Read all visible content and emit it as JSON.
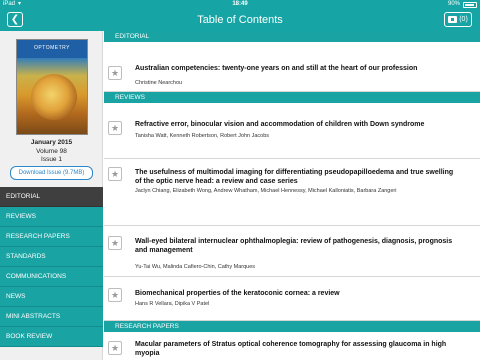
{
  "status_bar": {
    "device": "iPad",
    "time": "18:49",
    "battery": "90%",
    "battery_level": 0.9
  },
  "nav": {
    "title": "Table of Contents",
    "back_icon": "chevron-left-icon",
    "download_count": "(0)",
    "download_icon": "box-icon"
  },
  "issue": {
    "journal_cover_title": "OPTOMETRY",
    "date": "January 2015",
    "volume": "Volume 98",
    "issue": "Issue 1",
    "download_label": "Download Issue (9.7MB)"
  },
  "menu": [
    {
      "label": "EDITORIAL",
      "active": true
    },
    {
      "label": "REVIEWS",
      "active": false
    },
    {
      "label": "RESEARCH PAPERS",
      "active": false
    },
    {
      "label": "STANDARDS",
      "active": false
    },
    {
      "label": "COMMUNICATIONS",
      "active": false
    },
    {
      "label": "NEWS",
      "active": false
    },
    {
      "label": "MINI ABSTRACTS",
      "active": false
    },
    {
      "label": "BOOK REVIEW",
      "active": false
    }
  ],
  "sections": {
    "editorial": {
      "header": "EDITORIAL",
      "articles": [
        {
          "title": "Australian competencies: twenty-one years on and still at the heart of our profession",
          "authors": "Christine Nearchou"
        }
      ]
    },
    "reviews": {
      "header": "REVIEWS",
      "articles": [
        {
          "title": "Refractive error, binocular vision and accommodation of children with Down syndrome",
          "authors": "Tanisha Watt, Kenneth Robertson, Robert John Jacobs"
        },
        {
          "title": "The usefulness of multimodal imaging for differentiating pseudopapilloedema and true swelling of the optic nerve head: a review and case series",
          "authors": "Jaclyn Chiang, Elizabeth Wong, Andrew Whatham, Michael Hennessy, Michael Kalloniatis, Barbara Zangeri"
        },
        {
          "title": "Wall-eyed bilateral internuclear ophthalmoplegia: review of pathogenesis, diagnosis, prognosis and management",
          "authors": "Yu-Tai Wu, Malinda Cafiero-Chin, Cathy Marques"
        },
        {
          "title": "Biomechanical properties of the keratoconic cornea: a review",
          "authors": "Hans R Vellara, Dipika V Patel"
        }
      ]
    },
    "research": {
      "header": "RESEARCH PAPERS",
      "articles": [
        {
          "title": "Macular parameters of Stratus optical coherence tomography for assessing glaucoma in high myopia",
          "authors": ""
        }
      ]
    }
  }
}
